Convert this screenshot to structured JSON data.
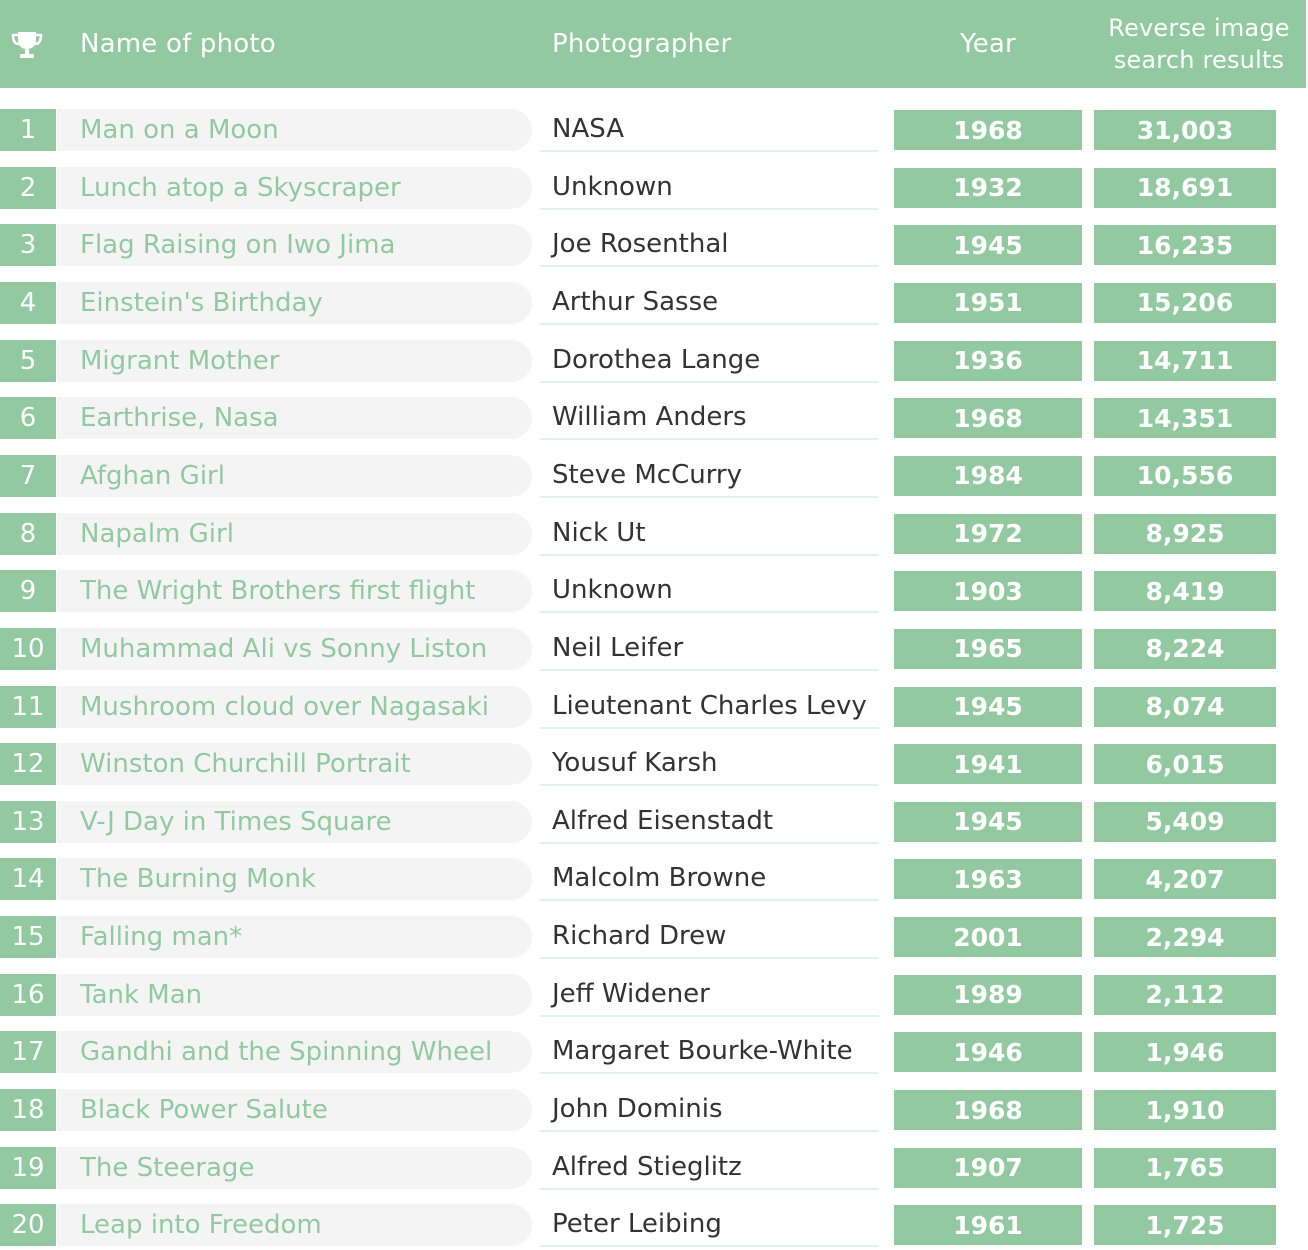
{
  "header": {
    "name_label": "Name of photo",
    "photographer_label": "Photographer",
    "year_label": "Year",
    "reverse_label_line1": "Reverse image",
    "reverse_label_line2": "search results"
  },
  "colors": {
    "accent": "#92c9a0",
    "name_bg": "#f4f4f4",
    "text_dark": "#333333"
  },
  "rows": [
    {
      "rank": "1",
      "name": "Man on a Moon",
      "photographer": "NASA",
      "year": "1968",
      "results": "31,003"
    },
    {
      "rank": "2",
      "name": "Lunch atop a Skyscraper",
      "photographer": "Unknown",
      "year": "1932",
      "results": "18,691"
    },
    {
      "rank": "3",
      "name": "Flag Raising on Iwo Jima",
      "photographer": "Joe Rosenthal",
      "year": "1945",
      "results": "16,235"
    },
    {
      "rank": "4",
      "name": "Einstein's Birthday",
      "photographer": "Arthur Sasse",
      "year": "1951",
      "results": "15,206"
    },
    {
      "rank": "5",
      "name": "Migrant Mother",
      "photographer": "Dorothea Lange",
      "year": "1936",
      "results": "14,711"
    },
    {
      "rank": "6",
      "name": "Earthrise, Nasa",
      "photographer": "William Anders",
      "year": "1968",
      "results": "14,351"
    },
    {
      "rank": "7",
      "name": "Afghan Girl",
      "photographer": "Steve McCurry",
      "year": "1984",
      "results": "10,556"
    },
    {
      "rank": "8",
      "name": "Napalm Girl",
      "photographer": "Nick Ut",
      "year": "1972",
      "results": "8,925"
    },
    {
      "rank": "9",
      "name": "The Wright Brothers first flight",
      "photographer": "Unknown",
      "year": "1903",
      "results": "8,419"
    },
    {
      "rank": "10",
      "name": "Muhammad Ali vs Sonny Liston",
      "photographer": "Neil Leifer",
      "year": "1965",
      "results": "8,224"
    },
    {
      "rank": "11",
      "name": "Mushroom cloud over Nagasaki",
      "photographer": "Lieutenant Charles Levy",
      "year": "1945",
      "results": "8,074"
    },
    {
      "rank": "12",
      "name": "Winston Churchill Portrait",
      "photographer": "Yousuf Karsh",
      "year": "1941",
      "results": "6,015"
    },
    {
      "rank": "13",
      "name": "V-J Day in Times Square",
      "photographer": "Alfred Eisenstadt",
      "year": "1945",
      "results": "5,409"
    },
    {
      "rank": "14",
      "name": "The Burning Monk",
      "photographer": "Malcolm Browne",
      "year": "1963",
      "results": "4,207"
    },
    {
      "rank": "15",
      "name": "Falling man*",
      "photographer": "Richard Drew",
      "year": "2001",
      "results": "2,294"
    },
    {
      "rank": "16",
      "name": "Tank Man",
      "photographer": "Jeff Widener",
      "year": "1989",
      "results": "2,112"
    },
    {
      "rank": "17",
      "name": "Gandhi and the Spinning Wheel",
      "photographer": "Margaret Bourke-White",
      "year": "1946",
      "results": "1,946"
    },
    {
      "rank": "18",
      "name": "Black Power Salute",
      "photographer": "John Dominis",
      "year": "1968",
      "results": "1,910"
    },
    {
      "rank": "19",
      "name": "The Steerage",
      "photographer": "Alfred Stieglitz",
      "year": "1907",
      "results": "1,765"
    },
    {
      "rank": "20",
      "name": "Leap into Freedom",
      "photographer": "Peter Leibing",
      "year": "1961",
      "results": "1,725"
    }
  ]
}
